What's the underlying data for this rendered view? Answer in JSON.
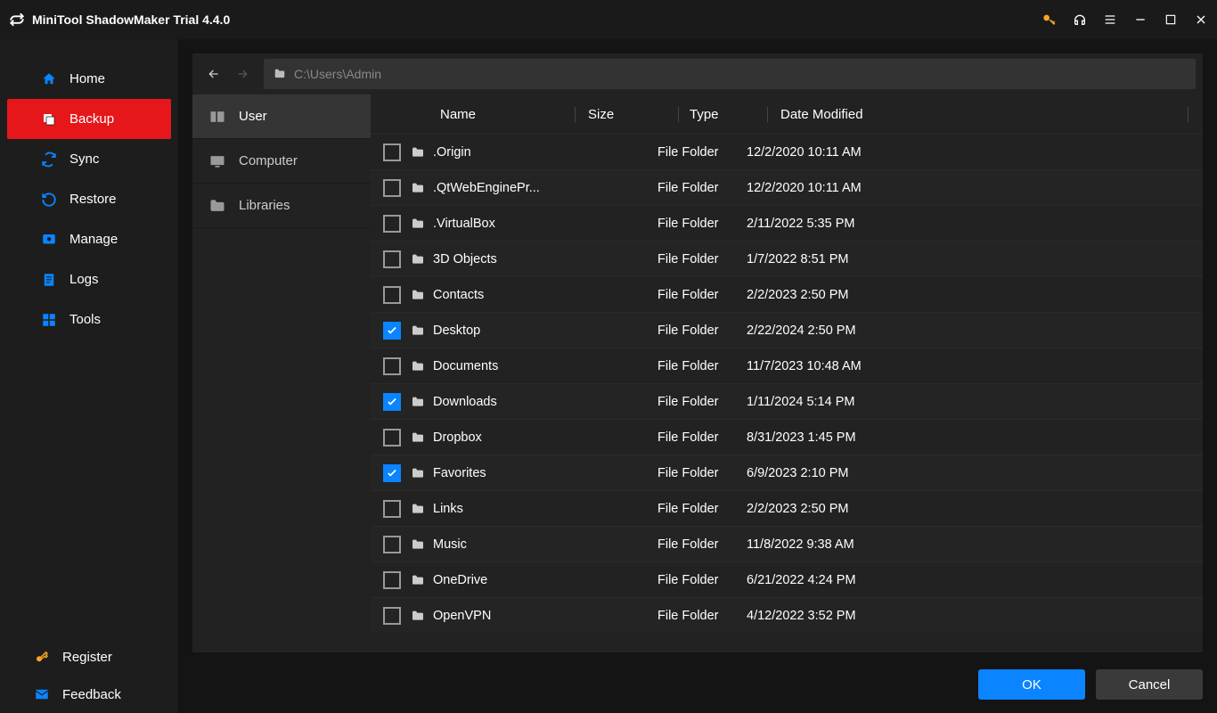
{
  "app_title": "MiniTool ShadowMaker Trial 4.4.0",
  "sidebar": {
    "items": [
      {
        "id": "home",
        "label": "Home",
        "icon": "home"
      },
      {
        "id": "backup",
        "label": "Backup",
        "icon": "backup"
      },
      {
        "id": "sync",
        "label": "Sync",
        "icon": "sync"
      },
      {
        "id": "restore",
        "label": "Restore",
        "icon": "restore"
      },
      {
        "id": "manage",
        "label": "Manage",
        "icon": "manage"
      },
      {
        "id": "logs",
        "label": "Logs",
        "icon": "logs"
      },
      {
        "id": "tools",
        "label": "Tools",
        "icon": "tools"
      }
    ],
    "active": "backup",
    "bottom": [
      {
        "id": "register",
        "label": "Register",
        "icon": "key"
      },
      {
        "id": "feedback",
        "label": "Feedback",
        "icon": "mail"
      }
    ]
  },
  "path": "C:\\Users\\Admin",
  "tree": {
    "items": [
      {
        "id": "user",
        "label": "User"
      },
      {
        "id": "computer",
        "label": "Computer"
      },
      {
        "id": "libraries",
        "label": "Libraries"
      }
    ],
    "active": "user"
  },
  "columns": {
    "name": "Name",
    "size": "Size",
    "type": "Type",
    "date": "Date Modified"
  },
  "files": [
    {
      "name": ".Origin",
      "type": "File Folder",
      "date": "12/2/2020 10:11 AM",
      "checked": false
    },
    {
      "name": ".QtWebEnginePr...",
      "type": "File Folder",
      "date": "12/2/2020 10:11 AM",
      "checked": false
    },
    {
      "name": ".VirtualBox",
      "type": "File Folder",
      "date": "2/11/2022 5:35 PM",
      "checked": false
    },
    {
      "name": "3D Objects",
      "type": "File Folder",
      "date": "1/7/2022 8:51 PM",
      "checked": false
    },
    {
      "name": "Contacts",
      "type": "File Folder",
      "date": "2/2/2023 2:50 PM",
      "checked": false
    },
    {
      "name": "Desktop",
      "type": "File Folder",
      "date": "2/22/2024 2:50 PM",
      "checked": true
    },
    {
      "name": "Documents",
      "type": "File Folder",
      "date": "11/7/2023 10:48 AM",
      "checked": false
    },
    {
      "name": "Downloads",
      "type": "File Folder",
      "date": "1/11/2024 5:14 PM",
      "checked": true
    },
    {
      "name": "Dropbox",
      "type": "File Folder",
      "date": "8/31/2023 1:45 PM",
      "checked": false
    },
    {
      "name": "Favorites",
      "type": "File Folder",
      "date": "6/9/2023 2:10 PM",
      "checked": true
    },
    {
      "name": "Links",
      "type": "File Folder",
      "date": "2/2/2023 2:50 PM",
      "checked": false
    },
    {
      "name": "Music",
      "type": "File Folder",
      "date": "11/8/2022 9:38 AM",
      "checked": false
    },
    {
      "name": "OneDrive",
      "type": "File Folder",
      "date": "6/21/2022 4:24 PM",
      "checked": false
    },
    {
      "name": "OpenVPN",
      "type": "File Folder",
      "date": "4/12/2022 3:52 PM",
      "checked": false
    }
  ],
  "buttons": {
    "ok": "OK",
    "cancel": "Cancel"
  }
}
